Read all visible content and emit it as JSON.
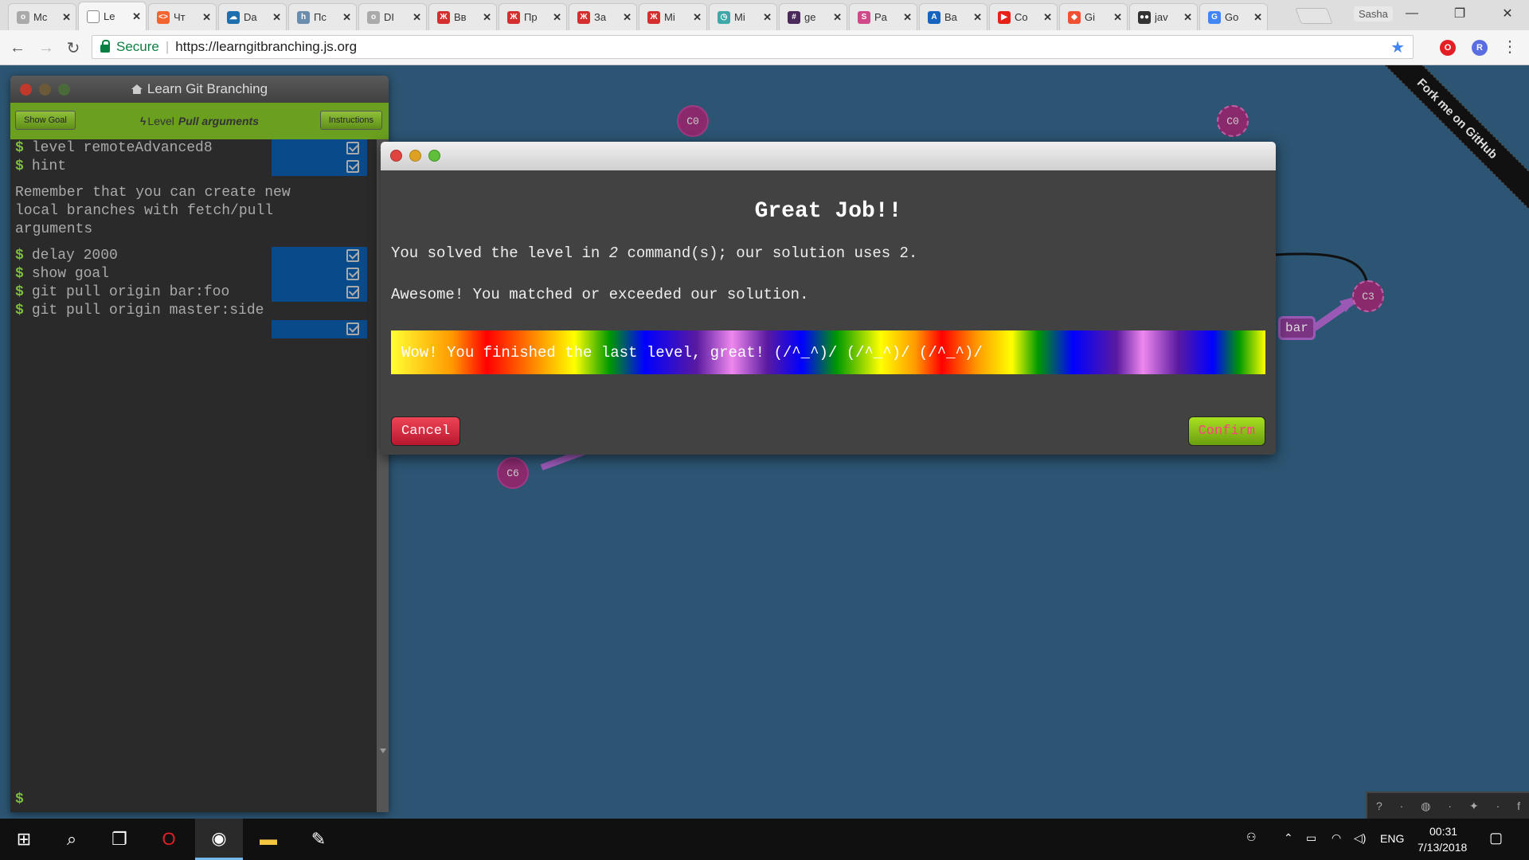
{
  "browser": {
    "tabs": [
      {
        "label": "Mc",
        "favicon_color": "#aaaaaa",
        "favicon_glyph": "o"
      },
      {
        "label": "Le",
        "favicon_color": "#ffffff",
        "favicon_glyph": "",
        "active": true
      },
      {
        "label": "Чт",
        "favicon_color": "#f26531",
        "favicon_glyph": "<>"
      },
      {
        "label": "Da",
        "favicon_color": "#1e6fae",
        "favicon_glyph": "☁"
      },
      {
        "label": "Пс",
        "favicon_color": "#6a8dad",
        "favicon_glyph": "h"
      },
      {
        "label": "DI",
        "favicon_color": "#aaaaaa",
        "favicon_glyph": "o"
      },
      {
        "label": "Вв",
        "favicon_color": "#d32f2f",
        "favicon_glyph": "Ж"
      },
      {
        "label": "Пр",
        "favicon_color": "#d32f2f",
        "favicon_glyph": "Ж"
      },
      {
        "label": "За",
        "favicon_color": "#d32f2f",
        "favicon_glyph": "Ж"
      },
      {
        "label": "Mi",
        "favicon_color": "#d32f2f",
        "favicon_glyph": "Ж"
      },
      {
        "label": "Mi",
        "favicon_color": "#3fa7a7",
        "favicon_glyph": "◷"
      },
      {
        "label": "ge",
        "favicon_color": "#4a2a5a",
        "favicon_glyph": "#"
      },
      {
        "label": "Pa",
        "favicon_color": "#d04a8a",
        "favicon_glyph": "S"
      },
      {
        "label": "Ba",
        "favicon_color": "#1565c0",
        "favicon_glyph": "A"
      },
      {
        "label": "Co",
        "favicon_color": "#e62117",
        "favicon_glyph": "▶"
      },
      {
        "label": "Gi",
        "favicon_color": "#f05133",
        "favicon_glyph": "◆"
      },
      {
        "label": "jav",
        "favicon_color": "#333333",
        "favicon_glyph": "●●"
      },
      {
        "label": "Go",
        "favicon_color": "#4285f4",
        "favicon_glyph": "G"
      }
    ],
    "profile_name": "Sasha",
    "secure_label": "Secure",
    "url": "https://learngitbranching.js.org"
  },
  "terminal": {
    "title": "Learn Git Branching",
    "show_goal_label": "Show Goal",
    "instructions_label": "Instructions",
    "level_prefix": "Level",
    "level_name": "Pull arguments",
    "commands_top": [
      "level remoteAdvanced8",
      "hint"
    ],
    "hint_text": "Remember that you can create new\nlocal branches with fetch/pull\narguments",
    "commands_bottom": [
      "delay 2000",
      "show goal",
      "git pull origin bar:foo",
      "git pull origin master:side"
    ],
    "prompt": "$"
  },
  "graph": {
    "commits": [
      "C0",
      "C0",
      "C3",
      "C6"
    ],
    "branch_bar": "bar"
  },
  "ribbon": "Fork me on GitHub",
  "modal": {
    "title": "Great Job!!",
    "line1_before": "You solved the level in ",
    "line1_count": "2",
    "line1_after": " command(s); our solution uses 2.",
    "line2": "Awesome! You matched or exceeded our solution.",
    "rainbow": "Wow! You finished the last level, great! (/^_^)/ (/^_^)/ (/^_^)/",
    "cancel": "Cancel",
    "confirm": "Confirm"
  },
  "taskbar": {
    "language": "ENG",
    "time": "00:31",
    "date": "7/13/2018"
  }
}
